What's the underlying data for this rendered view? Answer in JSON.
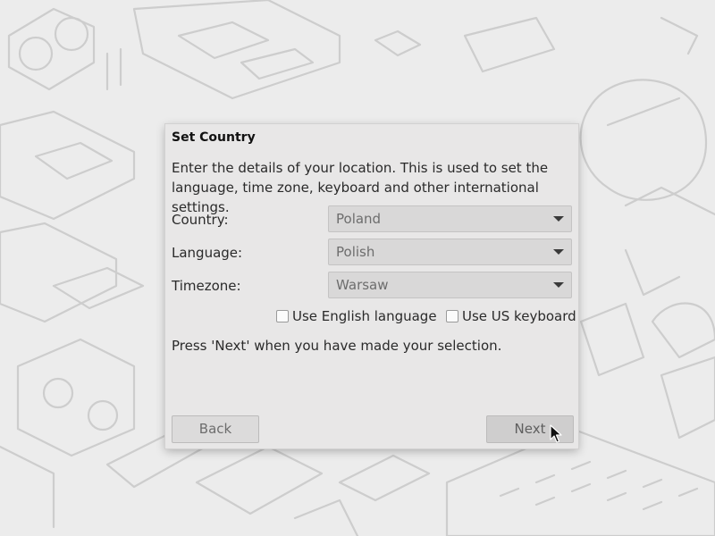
{
  "dialog": {
    "title": "Set Country",
    "description": "Enter the details of your location. This is used to set the language, time zone, keyboard and other international settings.",
    "country": {
      "label": "Country:",
      "value": "Poland"
    },
    "language": {
      "label": "Language:",
      "value": "Polish"
    },
    "timezone": {
      "label": "Timezone:",
      "value": "Warsaw"
    },
    "use_english": {
      "label": "Use English language",
      "checked": false
    },
    "use_us_keyboard": {
      "label": "Use US keyboard",
      "checked": false
    },
    "hint": "Press 'Next' when you have made your selection.",
    "back_label": "Back",
    "next_label": "Next"
  },
  "icons": {
    "dropdown": "chevron-down-icon",
    "pointer": "mouse-pointer-icon"
  },
  "colors": {
    "desktop_background": "#ececec",
    "wallpaper_line": "#cdcdcd",
    "dialog_background": "#e8e7e7"
  }
}
